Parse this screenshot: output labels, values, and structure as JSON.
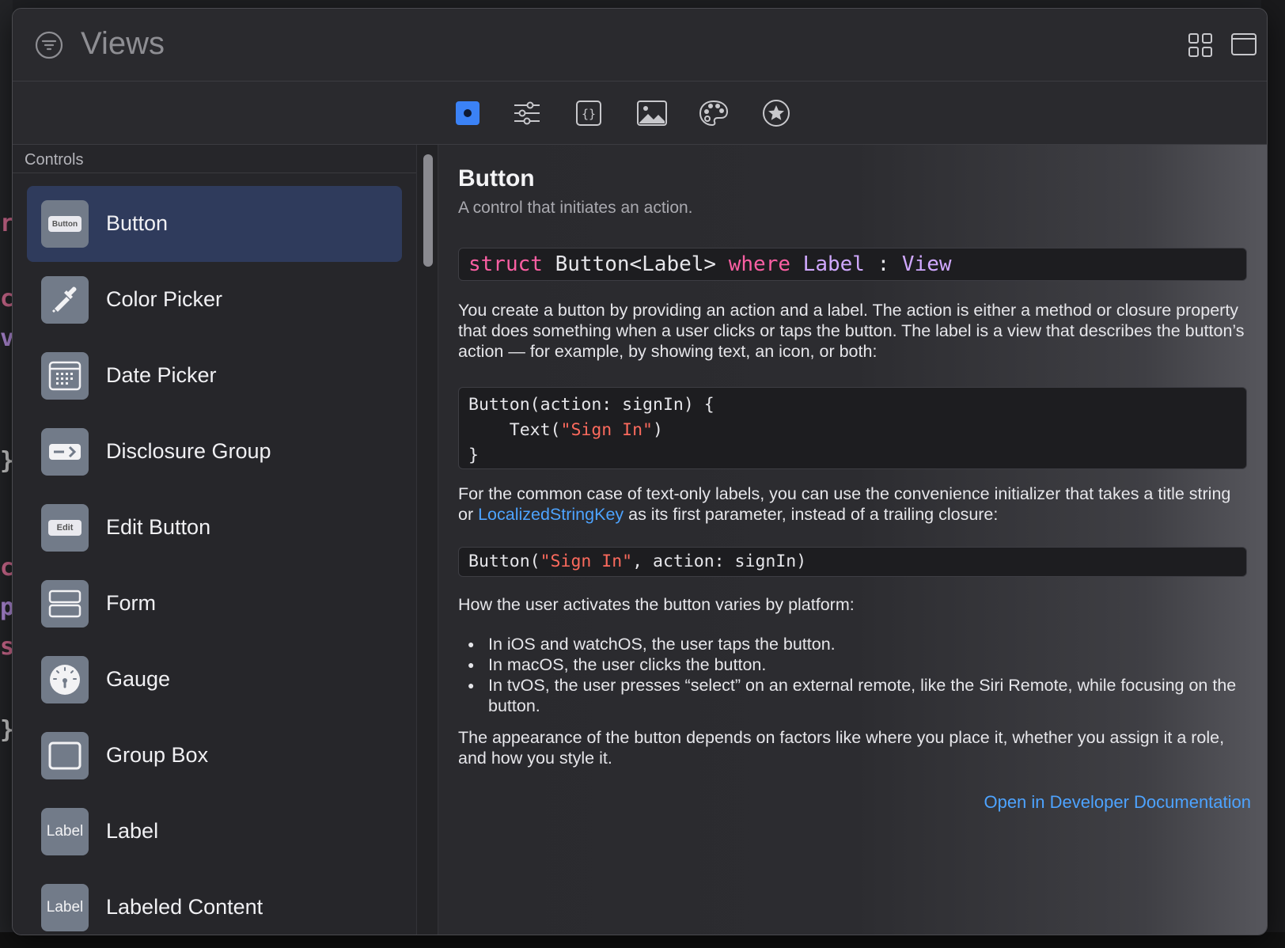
{
  "header": {
    "title": "Views",
    "filter_icon": "filter-icon",
    "grid_icon": "grid-view-icon",
    "window_icon": "window-icon"
  },
  "tabs": [
    {
      "id": "views",
      "icon": "views-tab-icon",
      "selected": true
    },
    {
      "id": "modifiers",
      "icon": "sliders-icon"
    },
    {
      "id": "snippets",
      "icon": "braces-icon"
    },
    {
      "id": "media",
      "icon": "image-icon"
    },
    {
      "id": "colors",
      "icon": "palette-icon"
    },
    {
      "id": "symbols",
      "icon": "star-circle-icon"
    }
  ],
  "sidebar": {
    "section_title": "Controls",
    "items": [
      {
        "label": "Button",
        "icon": "button-icon",
        "badge": "Button",
        "selected": true
      },
      {
        "label": "Color Picker",
        "icon": "eyedropper-icon"
      },
      {
        "label": "Date Picker",
        "icon": "calendar-icon"
      },
      {
        "label": "Disclosure Group",
        "icon": "disclosure-icon"
      },
      {
        "label": "Edit Button",
        "icon": "edit-button-icon",
        "badge": "Edit"
      },
      {
        "label": "Form",
        "icon": "form-icon"
      },
      {
        "label": "Gauge",
        "icon": "gauge-icon"
      },
      {
        "label": "Group Box",
        "icon": "group-box-icon"
      },
      {
        "label": "Label",
        "icon": "label-icon",
        "badge": "Label"
      },
      {
        "label": "Labeled Content",
        "icon": "labeled-content-icon",
        "badge": "Label"
      }
    ]
  },
  "detail": {
    "title": "Button",
    "subtitle": "A control that initiates an action.",
    "declaration": {
      "kw_struct": "struct",
      "name": " Button<Label> ",
      "kw_where": "where",
      "sp": " ",
      "label_type": "Label",
      "colon": " : ",
      "view_type": "View"
    },
    "para1": "You create a button by providing an action and a label. The action is either a method or closure property that does something when a user clicks or taps the button. The label is a view that describes the button’s action — for example, by showing text, an icon, or both:",
    "code1": {
      "line1": "Button(action: signIn) {",
      "line2_prefix": "    Text(",
      "line2_string": "\"Sign In\"",
      "line2_suffix": ")",
      "line3": "}"
    },
    "para2_before": "For the common case of text-only labels, you can use the convenience initializer that takes a title string or ",
    "para2_link": "LocalizedStringKey",
    "para2_after": " as its first parameter, instead of a trailing closure:",
    "code2": {
      "prefix": "Button(",
      "string": "\"Sign In\"",
      "suffix": ", action: signIn)"
    },
    "para3": "How the user activates the button varies by platform:",
    "bullets": [
      "In iOS and watchOS, the user taps the button.",
      "In macOS, the user clicks the button.",
      "In tvOS, the user presses “select” on an external remote, like the Siri Remote, while focusing on the button."
    ],
    "para4": "The appearance of the button depends on factors like where you place it, whether you assign it a role, and how you style it.",
    "open_link": "Open in Developer Documentation"
  },
  "colors": {
    "accent": "#3b82f6",
    "selected_row": "#2f3b5c",
    "link": "#4da3ff",
    "keyword": "#fc5fa3",
    "type": "#d0a8ff",
    "string": "#fc6a5d"
  }
}
